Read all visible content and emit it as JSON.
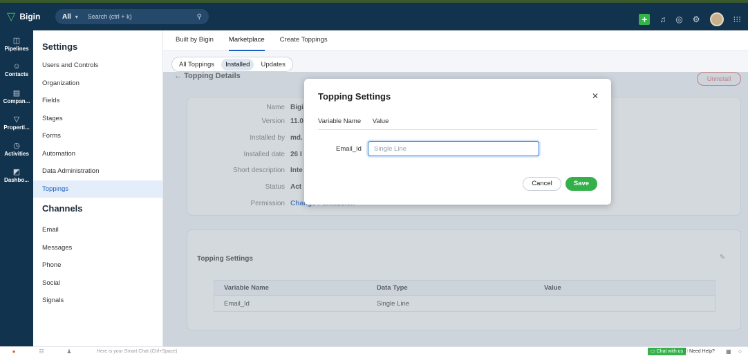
{
  "app": {
    "name": "Bigin",
    "logo_icon": "bigin-logo-icon"
  },
  "search": {
    "scope": "All",
    "placeholder": "Search (ctrl + k)"
  },
  "rail": [
    {
      "label": "Pipelines",
      "icon": "pipelines-icon"
    },
    {
      "label": "Contacts",
      "icon": "contacts-icon"
    },
    {
      "label": "Compan...",
      "icon": "companies-icon"
    },
    {
      "label": "Properti...",
      "icon": "properties-icon"
    },
    {
      "label": "Activities",
      "icon": "activities-icon"
    },
    {
      "label": "Dashbo...",
      "icon": "dashboards-icon"
    }
  ],
  "sidebar": {
    "settings_heading": "Settings",
    "items": [
      "Users and Controls",
      "Organization",
      "Fields",
      "Stages",
      "Forms",
      "Automation",
      "Data Administration",
      "Toppings"
    ],
    "channels_heading": "Channels",
    "channels": [
      "Email",
      "Messages",
      "Phone",
      "Social",
      "Signals"
    ]
  },
  "tabs": [
    "Built by Bigin",
    "Marketplace",
    "Create Toppings"
  ],
  "subtabs": [
    "All Toppings",
    "Installed",
    "Updates"
  ],
  "details": {
    "title": "Topping Details",
    "uninstall": "Uninstall",
    "rows": [
      {
        "key": "Name",
        "value": "Bigi"
      },
      {
        "key": "Version",
        "value": "11.0"
      },
      {
        "key": "Installed by",
        "value": "md."
      },
      {
        "key": "Installed date",
        "value": "26 I"
      },
      {
        "key": "Short description",
        "value": "Inte"
      },
      {
        "key": "Status",
        "value": "Act"
      },
      {
        "key": "Permission",
        "value": "Change Permission"
      }
    ]
  },
  "settings_card": {
    "title": "Topping Settings",
    "columns": [
      "Variable Name",
      "Data Type",
      "Value"
    ],
    "rows": [
      {
        "name": "Email_Id",
        "type": "Single Line",
        "value": ""
      }
    ]
  },
  "modal": {
    "title": "Topping Settings",
    "col_variable": "Variable Name",
    "col_value": "Value",
    "field_label": "Email_Id",
    "field_placeholder": "Single Line",
    "cancel": "Cancel",
    "save": "Save"
  },
  "bottom": {
    "hint": "Here is your Smart Chat (Ctrl+Space)",
    "chat": "Chat with us",
    "help": "Need Help?"
  },
  "colors": {
    "brand_dark": "#12334e",
    "accent_green": "#35b24a",
    "active_blue": "#1a5fc0"
  }
}
